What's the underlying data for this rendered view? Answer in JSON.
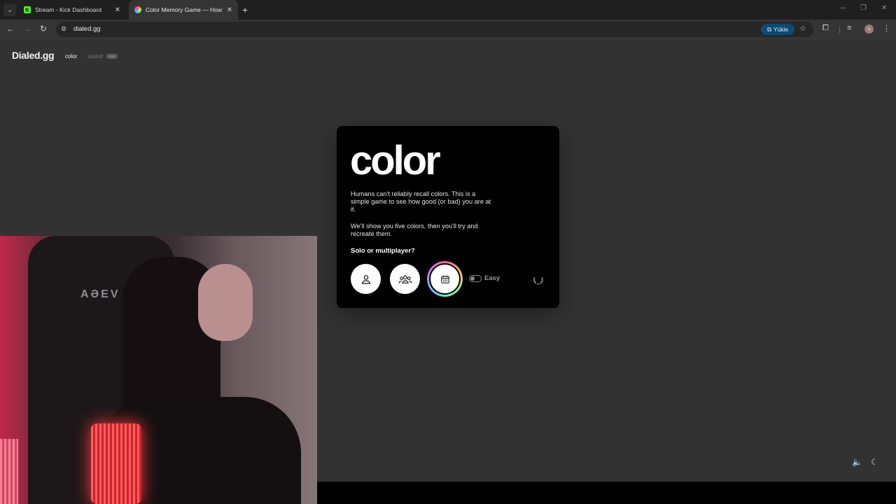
{
  "browser": {
    "tabs": [
      {
        "title": "Stream - Kick Dashboard",
        "favicon": "kick-icon"
      },
      {
        "title": "Color Memory Game — How W",
        "favicon": "color-wheel-icon",
        "active": true
      }
    ],
    "url": "dialed.gg",
    "install_label": "Yükle",
    "profile_initial": "s"
  },
  "site": {
    "logo": "Dialed.gg",
    "nav": {
      "color": "color",
      "sound": "sound",
      "sound_badge": "new"
    }
  },
  "game": {
    "title": "color",
    "intro": "Humans can't reliably recall colors. This is a simple game to see how good (or bad) you are at it.",
    "intro2": "We'll show you five colors, then you'll try and recreate them.",
    "question": "Solo or multiplayer?",
    "difficulty_label": "Easy",
    "difficulty_on": false
  },
  "overlay": {
    "webcam_chair_text": "AƏEV"
  },
  "colors": {
    "page_bg": "#323232",
    "card_bg": "#000000",
    "install_accent": "#0e4a74"
  }
}
